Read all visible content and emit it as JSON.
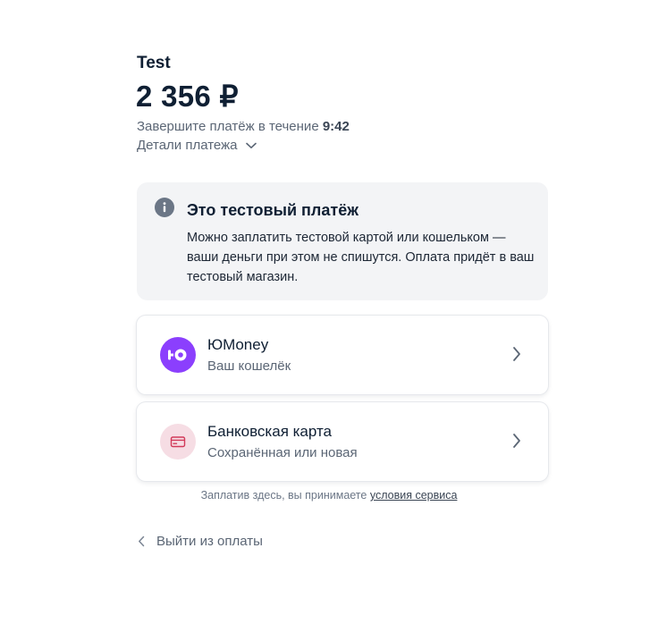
{
  "header": {
    "shop_name": "Test",
    "amount": "2 356 ₽",
    "deadline_prefix": "Завершите платёж в течение",
    "deadline_time": "9:42",
    "details_label": "Детали платежа"
  },
  "notice": {
    "icon": "info-icon",
    "title": "Это тестовый платёж",
    "text": "Можно заплатить тестовой картой или кошельком — ваши деньги при этом не спишутся. Оплата придёт в ваш тестовый магазин."
  },
  "methods": [
    {
      "name": "ЮMoney",
      "subtitle": "Ваш кошелёк",
      "icon": "yoomoney-logo-icon",
      "color": "#8b3ffd"
    },
    {
      "name": "Банковская карта",
      "subtitle": "Сохранённая или новая",
      "icon": "card-icon",
      "color": "#f6dde4"
    }
  ],
  "footer": {
    "terms_prefix": "Заплатив здесь, вы принимаете",
    "terms_link": "условия сервиса",
    "exit_label": "Выйти из оплаты"
  }
}
